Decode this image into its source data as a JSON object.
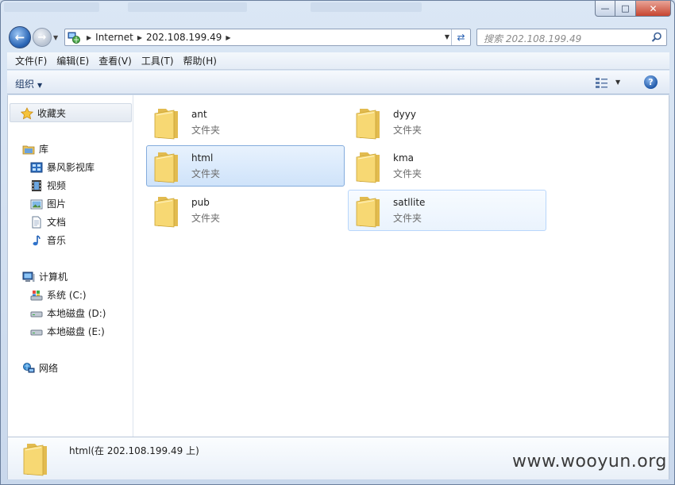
{
  "window": {
    "controls": {
      "minimize": "—",
      "maximize": "□",
      "close": "✕"
    }
  },
  "address": {
    "crumbs": [
      "Internet",
      "202.108.199.49"
    ],
    "search_placeholder": "搜索 202.108.199.49"
  },
  "menu": [
    "文件(F)",
    "编辑(E)",
    "查看(V)",
    "工具(T)",
    "帮助(H)"
  ],
  "toolbar": {
    "organize_label": "组织"
  },
  "nav": {
    "favorites": "收藏夹",
    "libraries": "库",
    "library_items": [
      "暴风影视库",
      "视频",
      "图片",
      "文档",
      "音乐"
    ],
    "computer": "计算机",
    "drives": [
      "系统 (C:)",
      "本地磁盘 (D:)",
      "本地磁盘 (E:)"
    ],
    "network": "网络"
  },
  "files": [
    {
      "name": "ant",
      "type": "文件夹",
      "state": "normal"
    },
    {
      "name": "dyyy",
      "type": "文件夹",
      "state": "normal"
    },
    {
      "name": "html",
      "type": "文件夹",
      "state": "selected"
    },
    {
      "name": "kma",
      "type": "文件夹",
      "state": "normal"
    },
    {
      "name": "pub",
      "type": "文件夹",
      "state": "normal"
    },
    {
      "name": "satllite",
      "type": "文件夹",
      "state": "hover"
    }
  ],
  "details": {
    "text": "html(在 202.108.199.49 上)"
  },
  "watermark": "www.wooyun.org",
  "colors": {
    "selection": "#cfe3fa",
    "selection_border": "#84acdd",
    "folder": "#f2cf6a"
  }
}
